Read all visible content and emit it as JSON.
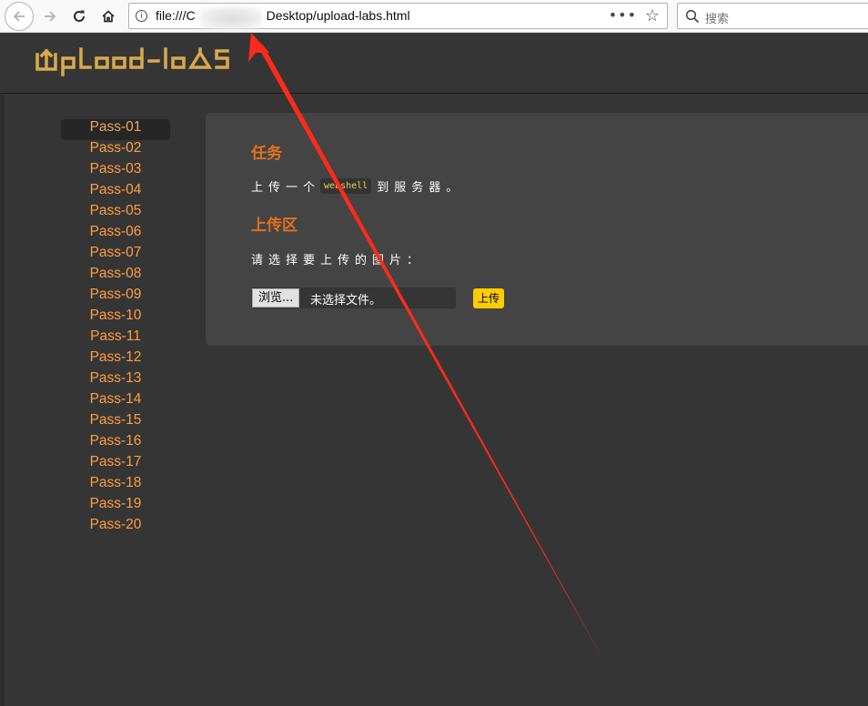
{
  "browser": {
    "url": "file:///C:/                Desktop/upload-labs.html",
    "url_prefix": "file:///C",
    "url_suffix": "Desktop/upload-labs.html",
    "search_placeholder": "搜索"
  },
  "site": {
    "logo_text": "UpLoad-labs"
  },
  "sidebar": {
    "items": [
      {
        "label": "Pass-01",
        "active": true
      },
      {
        "label": "Pass-02"
      },
      {
        "label": "Pass-03"
      },
      {
        "label": "Pass-04"
      },
      {
        "label": "Pass-05"
      },
      {
        "label": "Pass-06"
      },
      {
        "label": "Pass-07"
      },
      {
        "label": "Pass-08"
      },
      {
        "label": "Pass-09"
      },
      {
        "label": "Pass-10"
      },
      {
        "label": "Pass-11"
      },
      {
        "label": "Pass-12"
      },
      {
        "label": "Pass-13"
      },
      {
        "label": "Pass-14"
      },
      {
        "label": "Pass-15"
      },
      {
        "label": "Pass-16"
      },
      {
        "label": "Pass-17"
      },
      {
        "label": "Pass-18"
      },
      {
        "label": "Pass-19"
      },
      {
        "label": "Pass-20"
      }
    ]
  },
  "main": {
    "task_title": "任务",
    "task_prefix": "上传一个",
    "task_code": "webshell",
    "task_suffix": "到服务器。",
    "upload_title": "上传区",
    "upload_prompt": "请选择要上传的图片：",
    "browse_label": "浏览...",
    "file_status": "未选择文件。",
    "upload_button": "上传"
  },
  "colors": {
    "accent": "#e4711d",
    "menu_link": "#ff9d42",
    "logo": "#d9a94c",
    "upload_button": "#ffcc00",
    "annotation_arrow": "#ff2a1a"
  }
}
